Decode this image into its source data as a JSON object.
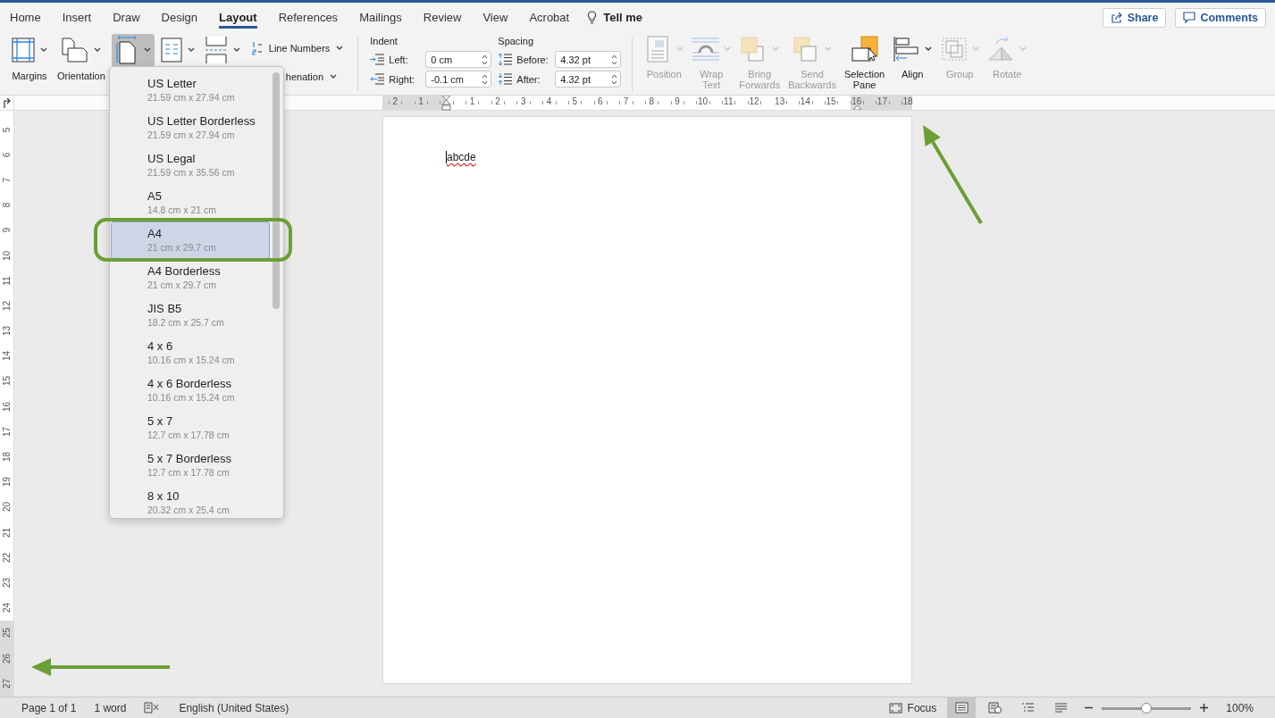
{
  "tabs": [
    {
      "label": "Home",
      "selected": false
    },
    {
      "label": "Insert",
      "selected": false
    },
    {
      "label": "Draw",
      "selected": false
    },
    {
      "label": "Design",
      "selected": false
    },
    {
      "label": "Layout",
      "selected": true
    },
    {
      "label": "References",
      "selected": false
    },
    {
      "label": "Mailings",
      "selected": false
    },
    {
      "label": "Review",
      "selected": false
    },
    {
      "label": "View",
      "selected": false
    },
    {
      "label": "Acrobat",
      "selected": false
    }
  ],
  "tell_me": {
    "label": "Tell me"
  },
  "header_buttons": [
    {
      "label": "Share"
    },
    {
      "label": "Comments"
    }
  ],
  "ribbon": {
    "page_setup": {
      "large_buttons": [
        {
          "label": "Margins",
          "pressed": false
        },
        {
          "label": "Orientation",
          "pressed": false
        },
        {
          "pressed": true
        },
        {
          "pressed": false
        },
        {
          "pressed": false
        }
      ],
      "small_buttons": [
        {
          "label": "Line Numbers"
        },
        {
          "label": "henation"
        }
      ]
    },
    "indent": {
      "title": "Indent",
      "fields": [
        {
          "label": "Left:",
          "value": "0 cm"
        },
        {
          "label": "Right:",
          "value": "-0.1 cm"
        }
      ]
    },
    "spacing": {
      "title": "Spacing",
      "fields": [
        {
          "label": "Before:",
          "value": "4.32 pt"
        },
        {
          "label": "After:",
          "value": "4.32 pt"
        }
      ]
    },
    "arrange": [
      {
        "label": "Position",
        "disabled": true
      },
      {
        "label": "Wrap Text",
        "disabled": true
      },
      {
        "label": "Bring Forwards",
        "disabled": true
      },
      {
        "label": "Send Backwards",
        "disabled": true
      },
      {
        "label": "Selection Pane",
        "disabled": false
      },
      {
        "label": "Align",
        "disabled": false
      },
      {
        "label": "Group",
        "disabled": true
      },
      {
        "label": "Rotate",
        "disabled": true
      }
    ]
  },
  "horizontal_ruler": {
    "left_labels": [
      "2",
      "1"
    ],
    "right_labels": [
      "1",
      "2",
      "3",
      "4",
      "5",
      "6",
      "7",
      "8",
      "9",
      "10",
      "11",
      "12",
      "13",
      "14",
      "15",
      "16",
      "17",
      "18"
    ]
  },
  "vertical_ruler": {
    "labels": [
      "5",
      "6",
      "7",
      "8",
      "9",
      "10",
      "11",
      "12",
      "13",
      "14",
      "15",
      "16",
      "17",
      "18",
      "19",
      "20",
      "21",
      "22",
      "23",
      "24",
      "25",
      "26",
      "27"
    ]
  },
  "page_size_menu": {
    "items": [
      {
        "name": "US Letter",
        "size": "21.59 cm x 27.94 cm",
        "selected": false
      },
      {
        "name": "US Letter Borderless",
        "size": "21.59 cm x 27.94 cm",
        "selected": false
      },
      {
        "name": "US Legal",
        "size": "21.59 cm x 35.56 cm",
        "selected": false
      },
      {
        "name": "A5",
        "size": "14.8 cm x 21 cm",
        "selected": false
      },
      {
        "name": "A4",
        "size": "21 cm x 29.7 cm",
        "selected": true
      },
      {
        "name": "A4 Borderless",
        "size": "21 cm x 29.7 cm",
        "selected": false
      },
      {
        "name": "JIS B5",
        "size": "18.2 cm x 25.7 cm",
        "selected": false
      },
      {
        "name": "4 x 6",
        "size": "10.16 cm x 15.24 cm",
        "selected": false
      },
      {
        "name": "4 x 6 Borderless",
        "size": "10.16 cm x 15.24 cm",
        "selected": false
      },
      {
        "name": "5 x 7",
        "size": "12.7 cm x 17.78 cm",
        "selected": false
      },
      {
        "name": "5 x 7 Borderless",
        "size": "12.7 cm x 17.78 cm",
        "selected": false
      },
      {
        "name": "8 x 10",
        "size": "20.32 cm x 25.4 cm",
        "selected": false
      }
    ]
  },
  "document": {
    "text": "abcde",
    "spelling_error": true
  },
  "status_bar": {
    "page": "Page 1 of 1",
    "words": "1 word",
    "language": "English (United States)",
    "focus": "Focus",
    "views": [
      {
        "selected": true
      },
      {
        "selected": false
      },
      {
        "selected": false
      },
      {
        "selected": false
      }
    ],
    "zoom": {
      "level": 0.5,
      "reading": "100%"
    }
  }
}
